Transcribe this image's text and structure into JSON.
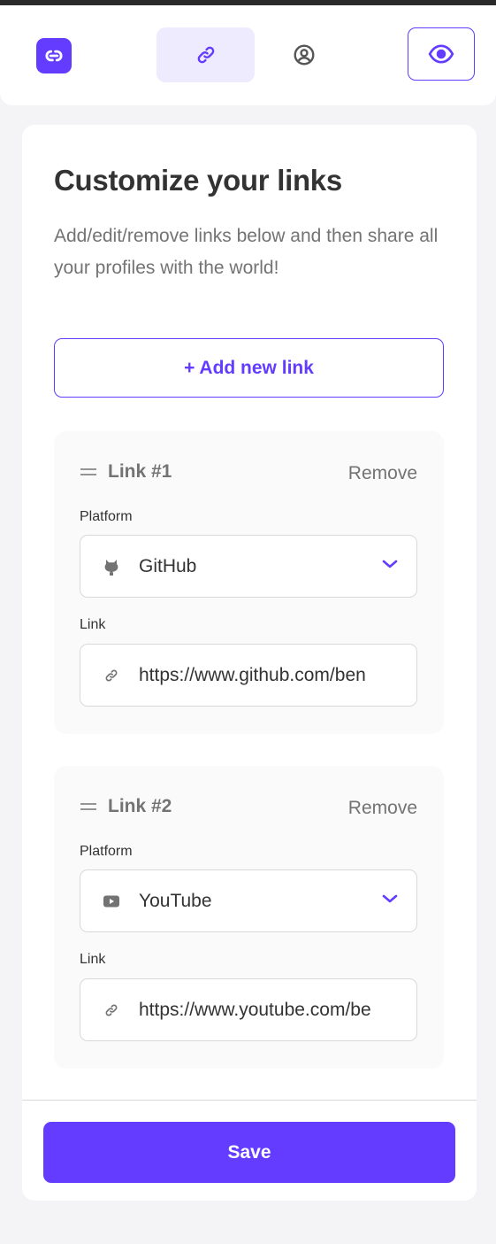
{
  "colors": {
    "accent": "#633cff",
    "accent_light": "#efebff",
    "text_dark": "#333333",
    "text_grey": "#737373",
    "border": "#d9d9d9"
  },
  "header": {
    "logo_icon": "link-chain-logo-icon",
    "tabs": [
      {
        "icon": "link-icon",
        "active": true
      },
      {
        "icon": "profile-circle-icon",
        "active": false
      }
    ],
    "preview_icon": "eye-icon"
  },
  "main": {
    "title": "Customize your links",
    "subtitle": "Add/edit/remove links below and then share all your profiles with the world!",
    "add_button": "+ Add new link",
    "links": [
      {
        "title": "Link #1",
        "remove": "Remove",
        "platform_label": "Platform",
        "platform": "GitHub",
        "platform_icon": "github-icon",
        "link_label": "Link",
        "url": "https://www.github.com/ben"
      },
      {
        "title": "Link #2",
        "remove": "Remove",
        "platform_label": "Platform",
        "platform": "YouTube",
        "platform_icon": "youtube-icon",
        "link_label": "Link",
        "url": "https://www.youtube.com/be"
      }
    ],
    "save_button": "Save"
  }
}
